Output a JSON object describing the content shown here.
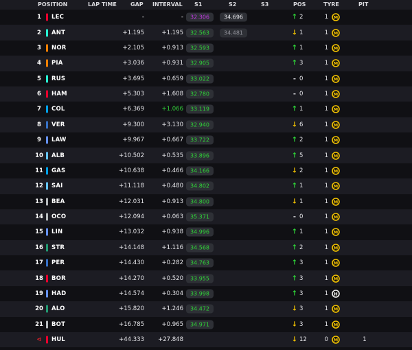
{
  "header": {
    "position": "POSITION",
    "lap_time": "LAP TIME",
    "gap": "GAP",
    "interval": "INTERVAL",
    "s1": "S1",
    "s2": "S2",
    "s3": "S3",
    "pos": "POS",
    "tyre": "TYRE",
    "pit": "PIT"
  },
  "colors": {
    "sector_green": "#2fd438",
    "sector_purple": "#c53be6",
    "gain": "#2fd438",
    "loss": "#f5c400",
    "retired": "#e0222a",
    "tyre_medium": "#f5c400"
  },
  "rows": [
    {
      "pos": "1",
      "team_color": "#e8002d",
      "code": "LEC",
      "gap": "-",
      "interval": "-",
      "interval_color": "white",
      "s1": "32.306",
      "s1_color": "purple",
      "s2": "34.696",
      "s2_color": "white",
      "direction": "up",
      "change": "2",
      "laps": "1",
      "tyre": "M",
      "tyre_icon": "medium-tyre-icon",
      "pit": ""
    },
    {
      "pos": "2",
      "team_color": "#27f4d2",
      "code": "ANT",
      "gap": "+1.195",
      "interval": "+1.195",
      "interval_color": "white",
      "s1": "32.563",
      "s1_color": "green",
      "s2": "34.481",
      "s2_color": "grey",
      "direction": "down",
      "change": "1",
      "laps": "1",
      "tyre": "M",
      "tyre_icon": "medium-tyre-icon",
      "pit": ""
    },
    {
      "pos": "3",
      "team_color": "#ff8000",
      "code": "NOR",
      "gap": "+2.105",
      "interval": "+0.913",
      "interval_color": "white",
      "s1": "32.593",
      "s1_color": "green",
      "s2": "",
      "s2_color": "",
      "direction": "up",
      "change": "1",
      "laps": "1",
      "tyre": "M",
      "tyre_icon": "medium-tyre-icon",
      "pit": ""
    },
    {
      "pos": "4",
      "team_color": "#ff8000",
      "code": "PIA",
      "gap": "+3.036",
      "interval": "+0.931",
      "interval_color": "white",
      "s1": "32.905",
      "s1_color": "green",
      "s2": "",
      "s2_color": "",
      "direction": "up",
      "change": "3",
      "laps": "1",
      "tyre": "M",
      "tyre_icon": "medium-tyre-icon",
      "pit": ""
    },
    {
      "pos": "5",
      "team_color": "#27f4d2",
      "code": "RUS",
      "gap": "+3.695",
      "interval": "+0.659",
      "interval_color": "white",
      "s1": "33.022",
      "s1_color": "green",
      "s2": "",
      "s2_color": "",
      "direction": "none",
      "change": "0",
      "laps": "1",
      "tyre": "M",
      "tyre_icon": "medium-tyre-icon",
      "pit": ""
    },
    {
      "pos": "6",
      "team_color": "#e8002d",
      "code": "HAM",
      "gap": "+5.303",
      "interval": "+1.608",
      "interval_color": "white",
      "s1": "32.780",
      "s1_color": "green",
      "s2": "",
      "s2_color": "",
      "direction": "none",
      "change": "0",
      "laps": "1",
      "tyre": "M",
      "tyre_icon": "medium-tyre-icon",
      "pit": ""
    },
    {
      "pos": "7",
      "team_color": "#00a1e8",
      "code": "COL",
      "gap": "+6.369",
      "interval": "+1.066",
      "interval_color": "green",
      "s1": "33.119",
      "s1_color": "green",
      "s2": "",
      "s2_color": "",
      "direction": "up",
      "change": "1",
      "laps": "1",
      "tyre": "M",
      "tyre_icon": "medium-tyre-icon",
      "pit": ""
    },
    {
      "pos": "8",
      "team_color": "#3671c6",
      "code": "VER",
      "gap": "+9.300",
      "interval": "+3.130",
      "interval_color": "white",
      "s1": "32.940",
      "s1_color": "green",
      "s2": "",
      "s2_color": "",
      "direction": "down",
      "change": "6",
      "laps": "1",
      "tyre": "M",
      "tyre_icon": "medium-tyre-icon",
      "pit": ""
    },
    {
      "pos": "9",
      "team_color": "#6692ff",
      "code": "LAW",
      "gap": "+9.967",
      "interval": "+0.667",
      "interval_color": "white",
      "s1": "33.722",
      "s1_color": "green",
      "s2": "",
      "s2_color": "",
      "direction": "up",
      "change": "2",
      "laps": "1",
      "tyre": "M",
      "tyre_icon": "medium-tyre-icon",
      "pit": ""
    },
    {
      "pos": "10",
      "team_color": "#64c4ff",
      "code": "ALB",
      "gap": "+10.502",
      "interval": "+0.535",
      "interval_color": "white",
      "s1": "33.896",
      "s1_color": "green",
      "s2": "",
      "s2_color": "",
      "direction": "up",
      "change": "5",
      "laps": "1",
      "tyre": "M",
      "tyre_icon": "medium-tyre-icon",
      "pit": ""
    },
    {
      "pos": "11",
      "team_color": "#00a1e8",
      "code": "GAS",
      "gap": "+10.638",
      "interval": "+0.466",
      "interval_color": "white",
      "s1": "34.166",
      "s1_color": "green",
      "s2": "",
      "s2_color": "",
      "direction": "down",
      "change": "2",
      "laps": "1",
      "tyre": "M",
      "tyre_icon": "medium-tyre-icon",
      "pit": ""
    },
    {
      "pos": "12",
      "team_color": "#64c4ff",
      "code": "SAI",
      "gap": "+11.118",
      "interval": "+0.480",
      "interval_color": "white",
      "s1": "34.802",
      "s1_color": "green",
      "s2": "",
      "s2_color": "",
      "direction": "up",
      "change": "1",
      "laps": "1",
      "tyre": "M",
      "tyre_icon": "medium-tyre-icon",
      "pit": ""
    },
    {
      "pos": "13",
      "team_color": "#b6babd",
      "code": "BEA",
      "gap": "+12.031",
      "interval": "+0.913",
      "interval_color": "white",
      "s1": "34.800",
      "s1_color": "green",
      "s2": "",
      "s2_color": "",
      "direction": "down",
      "change": "1",
      "laps": "1",
      "tyre": "M",
      "tyre_icon": "medium-tyre-icon",
      "pit": ""
    },
    {
      "pos": "14",
      "team_color": "#b6babd",
      "code": "OCO",
      "gap": "+12.094",
      "interval": "+0.063",
      "interval_color": "white",
      "s1": "35.371",
      "s1_color": "green",
      "s2": "",
      "s2_color": "",
      "direction": "none",
      "change": "0",
      "laps": "1",
      "tyre": "M",
      "tyre_icon": "medium-tyre-icon",
      "pit": ""
    },
    {
      "pos": "15",
      "team_color": "#6692ff",
      "code": "LIN",
      "gap": "+13.032",
      "interval": "+0.938",
      "interval_color": "white",
      "s1": "34.996",
      "s1_color": "green",
      "s2": "",
      "s2_color": "",
      "direction": "up",
      "change": "1",
      "laps": "1",
      "tyre": "M",
      "tyre_icon": "medium-tyre-icon",
      "pit": ""
    },
    {
      "pos": "16",
      "team_color": "#229971",
      "code": "STR",
      "gap": "+14.148",
      "interval": "+1.116",
      "interval_color": "white",
      "s1": "34.568",
      "s1_color": "green",
      "s2": "",
      "s2_color": "",
      "direction": "up",
      "change": "2",
      "laps": "1",
      "tyre": "M",
      "tyre_icon": "medium-tyre-icon",
      "pit": ""
    },
    {
      "pos": "17",
      "team_color": "#3671c6",
      "code": "PER",
      "gap": "+14.430",
      "interval": "+0.282",
      "interval_color": "white",
      "s1": "34.763",
      "s1_color": "green",
      "s2": "",
      "s2_color": "",
      "direction": "up",
      "change": "3",
      "laps": "1",
      "tyre": "M",
      "tyre_icon": "medium-tyre-icon",
      "pit": ""
    },
    {
      "pos": "18",
      "team_color": "#e8002d",
      "code": "BOR",
      "gap": "+14.270",
      "interval": "+0.520",
      "interval_color": "white",
      "s1": "33.955",
      "s1_color": "green",
      "s2": "",
      "s2_color": "",
      "direction": "up",
      "change": "3",
      "laps": "1",
      "tyre": "M",
      "tyre_icon": "medium-tyre-icon",
      "pit": ""
    },
    {
      "pos": "19",
      "team_color": "#6692ff",
      "code": "HAD",
      "gap": "+14.574",
      "interval": "+0.304",
      "interval_color": "white",
      "s1": "33.998",
      "s1_color": "green",
      "s2": "",
      "s2_color": "",
      "direction": "up",
      "change": "3",
      "laps": "1",
      "tyre": "H",
      "tyre_icon": "hard-tyre-icon",
      "pit": ""
    },
    {
      "pos": "20",
      "team_color": "#229971",
      "code": "ALO",
      "gap": "+15.820",
      "interval": "+1.246",
      "interval_color": "white",
      "s1": "34.472",
      "s1_color": "green",
      "s2": "",
      "s2_color": "",
      "direction": "down",
      "change": "3",
      "laps": "1",
      "tyre": "M",
      "tyre_icon": "medium-tyre-icon",
      "pit": ""
    },
    {
      "pos": "21",
      "team_color": "#b6babd",
      "code": "BOT",
      "gap": "+16.785",
      "interval": "+0.965",
      "interval_color": "white",
      "s1": "34.971",
      "s1_color": "green",
      "s2": "",
      "s2_color": "",
      "direction": "down",
      "change": "3",
      "laps": "1",
      "tyre": "M",
      "tyre_icon": "medium-tyre-icon",
      "pit": ""
    },
    {
      "pos": "⊲",
      "team_color": "#e8002d",
      "code": "HUL",
      "gap": "+44.333",
      "interval": "+27.848",
      "interval_color": "white",
      "s1": "",
      "s1_color": "",
      "s2": "",
      "s2_color": "",
      "direction": "down",
      "change": "12",
      "laps": "0",
      "tyre": "M",
      "tyre_icon": "medium-tyre-icon",
      "pit": "1",
      "retired": true
    }
  ]
}
